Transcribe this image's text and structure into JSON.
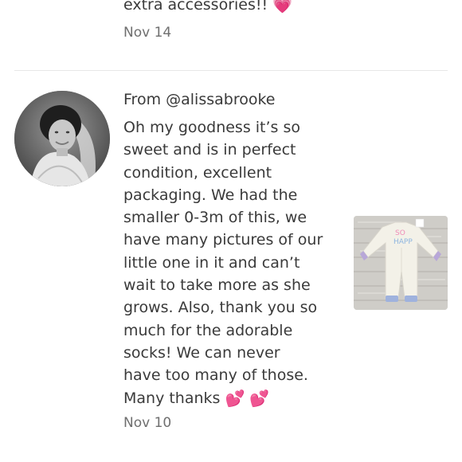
{
  "previous_review": {
    "text": "extra accessories!!",
    "emoji": "💗",
    "date": "Nov 14"
  },
  "review": {
    "from": "From @alissabrooke",
    "lines": [
      "Oh my goodness it’s so",
      "sweet and is in perfect",
      "condition, excellent",
      "packaging. We had the",
      "smaller 0-3m of this, we",
      "have many pictures of our",
      "little one in it and can’t",
      "wait to take more as she",
      "grows. Also, thank you so",
      "much for the adorable",
      "socks! We can never",
      "have too many of those.",
      "Many thanks"
    ],
    "emojis": [
      "💕",
      "💕"
    ],
    "date": "Nov 10"
  },
  "colors": {
    "text": "#3a3a3a",
    "date": "#6f6f6f",
    "divider": "#e7e7e7",
    "heart": "#f03aa6"
  }
}
